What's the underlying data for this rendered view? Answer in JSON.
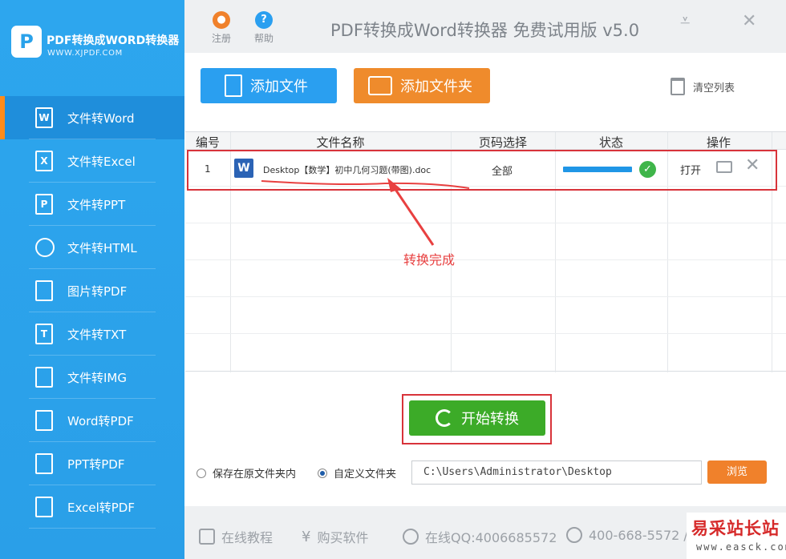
{
  "sidebar": {
    "logo_glyph": "P",
    "brand_name": "PDF转换成WORD转换器",
    "brand_url": "WWW.XJPDF.COM",
    "items": [
      {
        "label": "文件转Word",
        "icon_glyph": "W",
        "icon": "word-doc-icon",
        "active": true
      },
      {
        "label": "文件转Excel",
        "icon_glyph": "X",
        "icon": "excel-doc-icon"
      },
      {
        "label": "文件转PPT",
        "icon_glyph": "P",
        "icon": "ppt-doc-icon"
      },
      {
        "label": "文件转HTML",
        "icon_glyph": "",
        "icon": "globe-icon"
      },
      {
        "label": "图片转PDF",
        "icon_glyph": "",
        "icon": "pdf-doc-icon"
      },
      {
        "label": "文件转TXT",
        "icon_glyph": "T",
        "icon": "txt-doc-icon"
      },
      {
        "label": "文件转IMG",
        "icon_glyph": "",
        "icon": "image-icon"
      },
      {
        "label": "Word转PDF",
        "icon_glyph": "",
        "icon": "pdf-doc-icon"
      },
      {
        "label": "PPT转PDF",
        "icon_glyph": "",
        "icon": "pdf-doc-icon"
      },
      {
        "label": "Excel转PDF",
        "icon_glyph": "",
        "icon": "pdf-doc-icon"
      }
    ]
  },
  "titlebar": {
    "register_label": "注册",
    "help_label": "帮助",
    "title": "PDF转换成Word转换器 免费试用版 v5.0",
    "minimize_glyph": "⩡",
    "close_glyph": "✕"
  },
  "toolbar": {
    "add_file_label": "添加文件",
    "add_folder_label": "添加文件夹",
    "clear_list_label": "清空列表"
  },
  "table": {
    "headers": [
      "编号",
      "文件名称",
      "页码选择",
      "状态",
      "操作"
    ],
    "rows": [
      {
        "index": "1",
        "filename": "Desktop【数学】初中几何习题(带图).doc",
        "pages": "全部",
        "progress": 1.0,
        "open_label": "打开"
      }
    ]
  },
  "annotation": {
    "text": "转换完成"
  },
  "start_button_label": "开始转换",
  "save_options": {
    "original_folder_label": "保存在原文件夹内",
    "custom_folder_label": "自定义文件夹",
    "selected": "custom",
    "path_value": "C:\\Users\\Administrator\\Desktop",
    "browse_label": "浏览"
  },
  "footer": {
    "tutorial_label": "在线教程",
    "buy_label": "购买软件",
    "qq_label": "在线QQ:4006685572",
    "phone_label": "400-668-5572 /"
  },
  "watermark": {
    "main": "易采站长站",
    "sub": "www.easck.com"
  },
  "colors": {
    "sidebar_blue": "#2da6ee",
    "active_accent": "#ff8b1a",
    "add_file_blue": "#2a9ff0",
    "add_folder_orange": "#ef8b2c",
    "start_green": "#3cab28",
    "highlight_red": "#d8333a"
  }
}
